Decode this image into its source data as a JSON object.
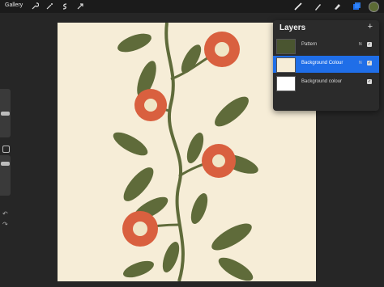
{
  "topbar": {
    "gallery_label": "Gallery",
    "left_tools": [
      "wrench-icon",
      "magic-wand-icon",
      "adjust-s-icon",
      "arrow-icon"
    ],
    "right_tools": [
      "brush-icon",
      "smudge-icon",
      "eraser-icon",
      "layers-icon"
    ],
    "active_color": "#5c6b34"
  },
  "layers_panel": {
    "title": "Layers",
    "add_label": "+",
    "rows": [
      {
        "name": "Pattern",
        "mode": "N",
        "visible": true,
        "active": false
      },
      {
        "name": "Background Colour",
        "mode": "N",
        "visible": true,
        "active": true
      },
      {
        "name": "Background colour",
        "mode": "",
        "visible": true,
        "active": false
      }
    ]
  },
  "colors": {
    "canvas_bg": "#f6edd7",
    "leaf": "#5f6b3a",
    "flower": "#d9603f",
    "center": "#f0e6c6",
    "accent": "#1f6ee8"
  }
}
